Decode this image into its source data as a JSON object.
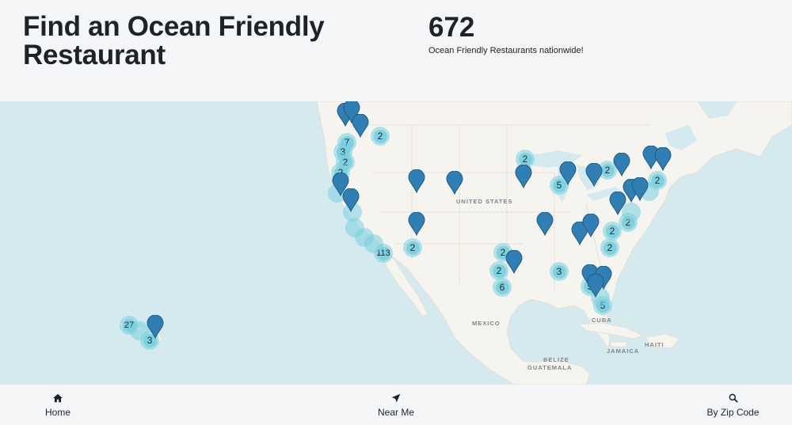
{
  "header": {
    "title": "Find an Ocean Friendly Restaurant",
    "count": "672",
    "count_subtitle": "Ocean Friendly Restaurants nationwide!"
  },
  "map": {
    "labels": {
      "united_states": "UNITED STATES",
      "mexico": "MEXICO",
      "cuba": "CUBA",
      "jamaica": "JAMAICA",
      "haiti": "HAITI",
      "belize": "BELIZE",
      "guatemala": "GUATEMALA"
    },
    "clusters": [
      {
        "label": "2"
      },
      {
        "label": "7"
      },
      {
        "label": "3"
      },
      {
        "label": "2"
      },
      {
        "label": "2"
      },
      {
        "label": "113"
      },
      {
        "label": "2"
      },
      {
        "label": "2"
      },
      {
        "label": "5"
      },
      {
        "label": "2"
      },
      {
        "label": "2"
      },
      {
        "label": "2"
      },
      {
        "label": "2"
      },
      {
        "label": "2"
      },
      {
        "label": "2"
      },
      {
        "label": "2"
      },
      {
        "label": "6"
      },
      {
        "label": "3"
      },
      {
        "label": "5"
      },
      {
        "label": "5"
      },
      {
        "label": "27"
      },
      {
        "label": "3"
      }
    ],
    "colors": {
      "water": "#d4eaef",
      "land": "#f6f4ef",
      "marker": "#2f7fb4",
      "cluster": "#79d0de"
    }
  },
  "nav": {
    "home": "Home",
    "near_me": "Near Me",
    "zip": "By Zip Code"
  }
}
